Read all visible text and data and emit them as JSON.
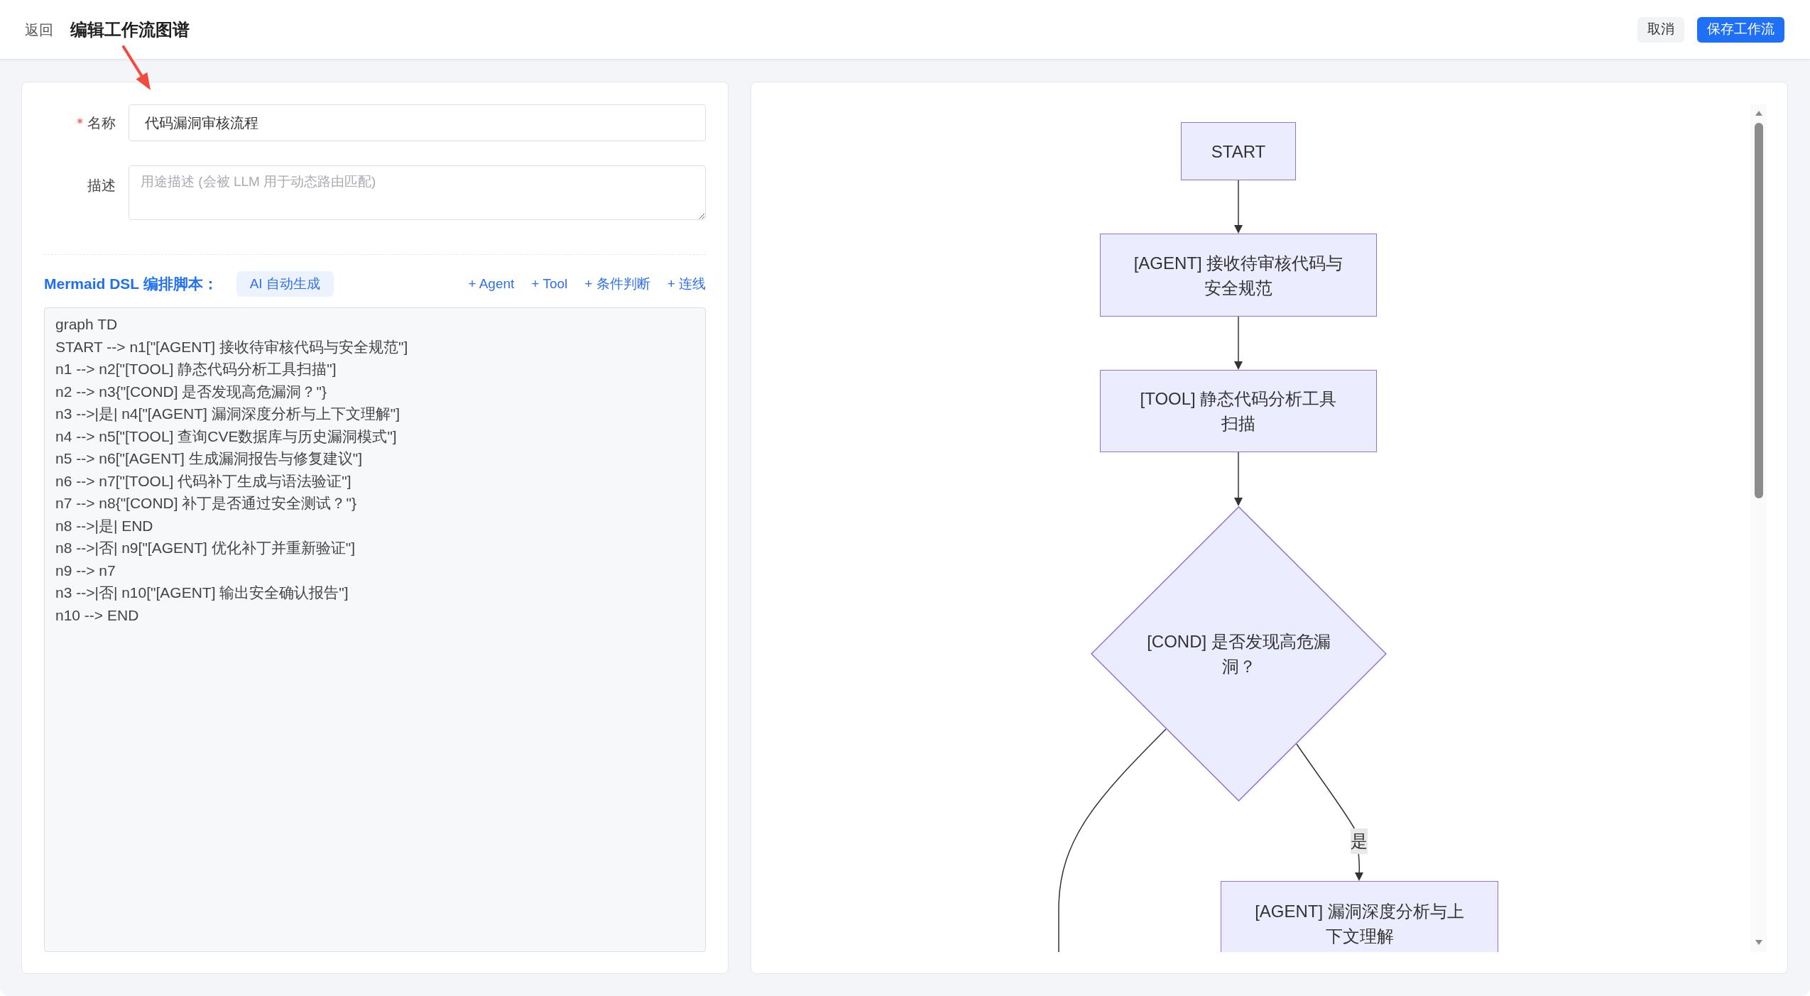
{
  "header": {
    "back": "返回",
    "title": "编辑工作流图谱",
    "buttons": [
      {
        "kind": "secondary",
        "label": "取消"
      },
      {
        "kind": "primary",
        "label": "保存工作流"
      }
    ]
  },
  "form": {
    "fields": [
      {
        "kind": "input",
        "label": "名称",
        "required": true,
        "value": "代码漏洞审核流程"
      },
      {
        "kind": "textarea",
        "label": "描述",
        "required": false,
        "placeholder": "用途描述 (会被 LLM 用于动态路由匹配)"
      }
    ]
  },
  "script": {
    "title": "Mermaid DSL 编排脚本：",
    "ai_button": "AI 自动生成",
    "insert_links": [
      "+ Agent",
      "+ Tool",
      "+ 条件判断",
      "+ 连线"
    ],
    "code_lines": [
      "graph TD",
      "START --> n1[\"[AGENT] 接收待审核代码与安全规范\"]",
      "n1 --> n2[\"[TOOL] 静态代码分析工具扫描\"]",
      "n2 --> n3{\"[COND] 是否发现高危漏洞？\"}",
      "n3 -->|是| n4[\"[AGENT] 漏洞深度分析与上下文理解\"]",
      "n4 --> n5[\"[TOOL] 查询CVE数据库与历史漏洞模式\"]",
      "n5 --> n6[\"[AGENT] 生成漏洞报告与修复建议\"]",
      "n6 --> n7[\"[TOOL] 代码补丁生成与语法验证\"]",
      "n7 --> n8{\"[COND] 补丁是否通过安全测试？\"}",
      "n8 -->|是| END",
      "n8 -->|否| n9[\"[AGENT] 优化补丁并重新验证\"]",
      "n9 --> n7",
      "n3 -->|否| n10[\"[AGENT] 输出安全确认报告\"]",
      "n10 --> END"
    ]
  },
  "diagram": {
    "nodes": [
      {
        "kind": "process",
        "label_lines": [
          "START"
        ]
      },
      {
        "kind": "process",
        "label_lines": [
          "[AGENT] 接收待审核代码与",
          "安全规范"
        ]
      },
      {
        "kind": "process",
        "label_lines": [
          "[TOOL] 静态代码分析工具",
          "扫描"
        ]
      },
      {
        "kind": "decision",
        "label_lines": [
          "[COND] 是否发现高危漏",
          "洞？"
        ]
      },
      {
        "kind": "process",
        "label_lines": [
          "[AGENT] 漏洞深度分析与上",
          "下文理解"
        ]
      }
    ],
    "edge_labels": [
      "是"
    ]
  }
}
